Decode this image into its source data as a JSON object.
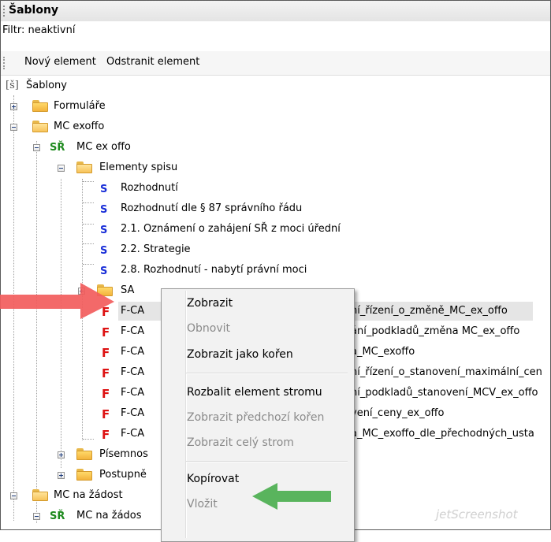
{
  "window": {
    "title": "Šablony"
  },
  "filter": {
    "text": "Filtr: neaktivní"
  },
  "toolbar": {
    "new_element": "Nový element",
    "remove_element": "Odstranit element"
  },
  "tree": {
    "root": {
      "icon": "[š]",
      "label": "Šablony"
    },
    "formulare": "Formuláře",
    "mc_exoffo": "MC exoffo",
    "mc_ex_offo": "MC ex offo",
    "elementy_spisu": "Elementy spisu",
    "s_items": [
      "Rozhodnutí",
      "Rozhodnutí dle § 87 správního řádu",
      "2.1. Oznámení o zahájení SŘ z moci úřední",
      "2.2. Strategie",
      "2.8. Rozhodnutí - nabytí právní moci"
    ],
    "sa": "SA",
    "f_items": [
      {
        "prefix": "F-CA",
        "suffix": "ní_řízení_o_změně_MC_ex_offo"
      },
      {
        "prefix": "F-CA",
        "suffix": "ání_podkladů_změna MC_ex_offo"
      },
      {
        "prefix": "F-CA",
        "suffix": "a_MC_exoffo"
      },
      {
        "prefix": "F-CA",
        "suffix": "ní_řízení_o_stanovení_maximální_cen"
      },
      {
        "prefix": "F-CA",
        "suffix": "ní_podkladů_stanovení_MCV_ex_offo"
      },
      {
        "prefix": "F-CA",
        "suffix": "vení_ceny_ex_offo"
      },
      {
        "prefix": "F-CA",
        "suffix": "a_MC_exoffo_dle_přechodných_usta"
      }
    ],
    "f_icon": "F",
    "s_icon": "S",
    "sr_icon": "SŘ",
    "pisemnosti": "Písemnos",
    "postupne": "Postupně",
    "mc_na_zadost": "MC na žádost",
    "mc_na_zadost_sr": "MC na žádos"
  },
  "context_menu": {
    "items": [
      {
        "label": "Zobrazit",
        "enabled": true
      },
      {
        "label": "Obnovit",
        "enabled": false
      },
      {
        "label": "Zobrazit jako kořen",
        "enabled": true
      },
      {
        "label": "Rozbalit element stromu",
        "enabled": true
      },
      {
        "label": "Zobrazit předchozí kořen",
        "enabled": false
      },
      {
        "label": "Zobrazit celý strom",
        "enabled": false
      },
      {
        "label": "Kopírovat",
        "enabled": true
      },
      {
        "label": "Vložit",
        "enabled": false
      }
    ]
  },
  "annotations": {
    "red_arrow_color": "#f25c5c",
    "green_arrow_color": "#4caf50"
  },
  "watermark": "jetScreenshot"
}
